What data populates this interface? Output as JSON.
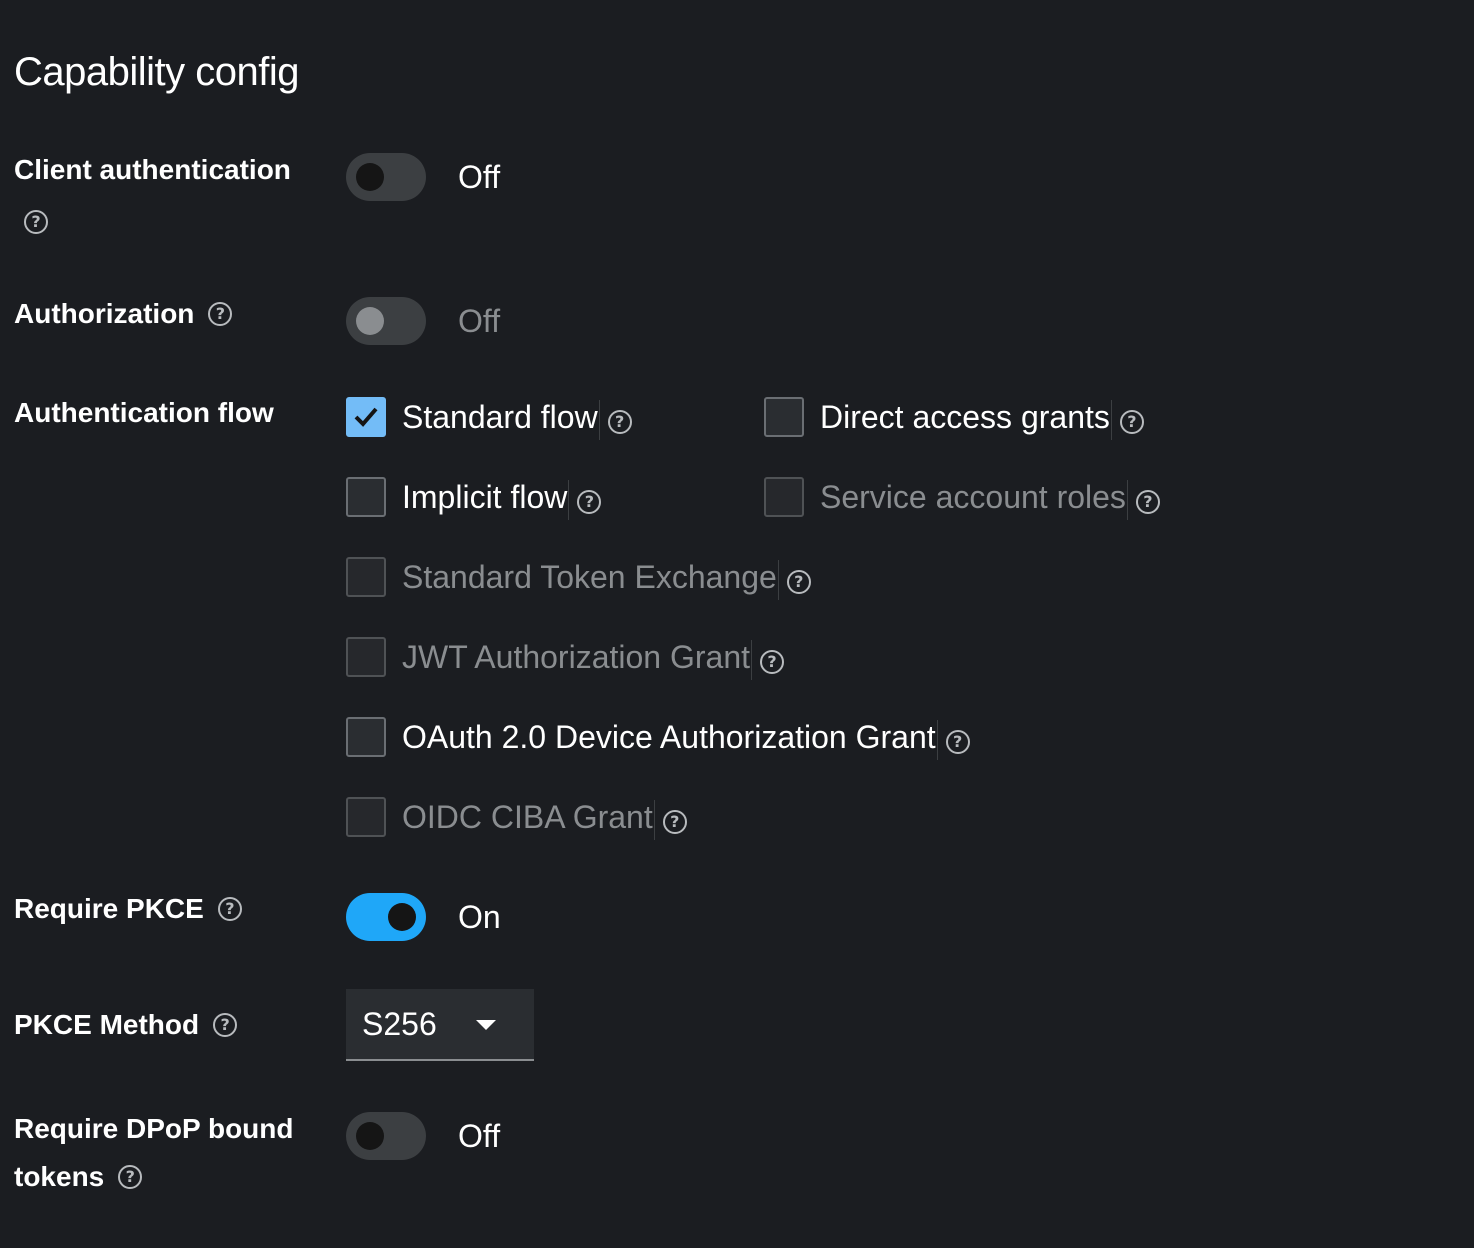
{
  "page": {
    "title": "Capability config"
  },
  "client_authentication": {
    "label": "Client authentication",
    "state": "Off"
  },
  "authorization": {
    "label": "Authorization",
    "state": "Off"
  },
  "authentication_flow": {
    "label": "Authentication flow",
    "options": {
      "standard_flow": {
        "label": "Standard flow",
        "checked": true
      },
      "direct_access_grants": {
        "label": "Direct access grants",
        "checked": false
      },
      "implicit_flow": {
        "label": "Implicit flow",
        "checked": false
      },
      "service_account_roles": {
        "label": "Service account roles",
        "checked": false
      },
      "standard_token_exchange": {
        "label": "Standard Token Exchange",
        "checked": false
      },
      "jwt_authorization_grant": {
        "label": "JWT Authorization Grant",
        "checked": false
      },
      "oauth_device_grant": {
        "label": "OAuth 2.0 Device Authorization Grant",
        "checked": false
      },
      "oidc_ciba_grant": {
        "label": "OIDC CIBA Grant",
        "checked": false
      }
    }
  },
  "require_pkce": {
    "label": "Require PKCE",
    "state": "On"
  },
  "pkce_method": {
    "label": "PKCE Method",
    "value": "S256"
  },
  "require_dpop": {
    "label_line1": "Require DPoP bound",
    "label_line2": "tokens",
    "state": "Off"
  },
  "icons": {
    "help": "?"
  },
  "colors": {
    "background": "#1b1d21",
    "accent": "#1fa7f8",
    "checkbox_checked": "#73bcf7"
  }
}
